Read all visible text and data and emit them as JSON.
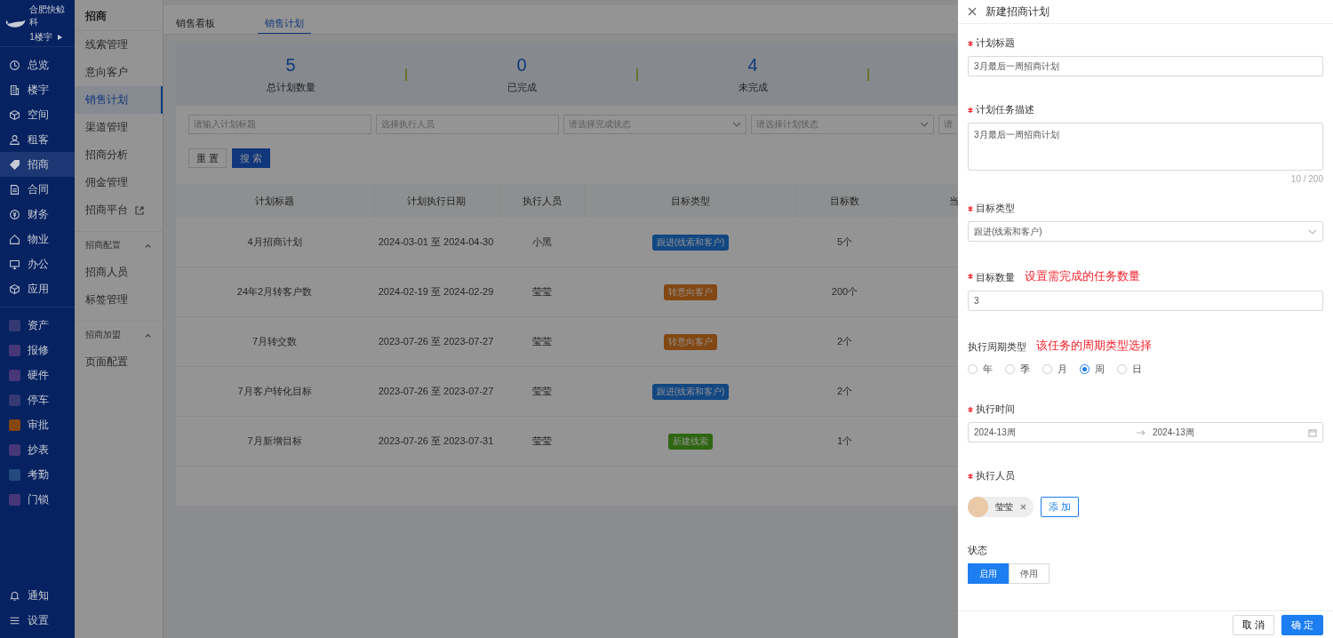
{
  "sidebar": {
    "org_name": "合肥快鲸科",
    "building": "1楼宇",
    "items": [
      {
        "kind": "nav",
        "label": "总览",
        "selected": false
      },
      {
        "kind": "nav",
        "label": "楼宇",
        "selected": false
      },
      {
        "kind": "nav",
        "label": "空间",
        "selected": false
      },
      {
        "kind": "nav",
        "label": "租客",
        "selected": false
      },
      {
        "kind": "nav",
        "label": "招商",
        "selected": true
      },
      {
        "kind": "nav",
        "label": "合同",
        "selected": false
      },
      {
        "kind": "nav",
        "label": "财务",
        "selected": false
      },
      {
        "kind": "nav",
        "label": "物业",
        "selected": false
      },
      {
        "kind": "nav",
        "label": "办公",
        "selected": false
      },
      {
        "kind": "nav",
        "label": "应用",
        "selected": false
      },
      {
        "kind": "app",
        "label": "资产",
        "color": "#343974",
        "selected": false
      },
      {
        "kind": "app",
        "label": "报修",
        "color": "#473779",
        "selected": false
      },
      {
        "kind": "app",
        "label": "硬件",
        "color": "#473779",
        "selected": false
      },
      {
        "kind": "app",
        "label": "停车",
        "color": "#343974",
        "selected": false
      },
      {
        "kind": "app",
        "label": "审批",
        "color": "#864611",
        "selected": false
      },
      {
        "kind": "app",
        "label": "抄表",
        "color": "#473779",
        "selected": false
      },
      {
        "kind": "app",
        "label": "考勤",
        "color": "#224a7d",
        "selected": false
      },
      {
        "kind": "app",
        "label": "门锁",
        "color": "#473779",
        "selected": false
      }
    ],
    "bottom_items": [
      {
        "label": "通知"
      },
      {
        "label": "设置"
      }
    ]
  },
  "submenu": {
    "title": "招商",
    "items": [
      {
        "label": "线索管理",
        "selected": false
      },
      {
        "label": "意向客户",
        "selected": false
      },
      {
        "label": "销售计划",
        "selected": true
      },
      {
        "label": "渠道管理",
        "selected": false
      },
      {
        "label": "招商分析",
        "selected": false
      },
      {
        "label": "佣金管理",
        "selected": false
      },
      {
        "label": "招商平台",
        "selected": false,
        "external": true
      }
    ],
    "groups": [
      {
        "title": "招商配置",
        "expanded": true,
        "items": [
          {
            "label": "招商人员",
            "selected": false
          },
          {
            "label": "标签管理",
            "selected": false
          }
        ]
      },
      {
        "title": "招商加盟",
        "expanded": true,
        "items": [
          {
            "label": "页面配置",
            "selected": false
          }
        ]
      }
    ]
  },
  "tabs": [
    {
      "label": "销售看板",
      "selected": false
    },
    {
      "label": "销售计划",
      "selected": true
    }
  ],
  "stats": [
    {
      "value": "5",
      "label": "总计划数量"
    },
    {
      "value": "0",
      "label": "已完成"
    },
    {
      "value": "4",
      "label": "未完成"
    }
  ],
  "filters": [
    {
      "kind": "input",
      "placeholder": "请输入计划标题"
    },
    {
      "kind": "input",
      "placeholder": "选择执行人员"
    },
    {
      "kind": "select",
      "placeholder": "请选择完成状态"
    },
    {
      "kind": "select",
      "placeholder": "请选择计划状态"
    },
    {
      "kind": "input",
      "placeholder": "请"
    }
  ],
  "filter_buttons": {
    "reset": "重 置",
    "search": "搜 索"
  },
  "table": {
    "columns": [
      "计划标题",
      "计划执行日期",
      "执行人员",
      "目标类型",
      "目标数",
      "当"
    ],
    "rows": [
      {
        "title": "4月招商计划",
        "date": "2024-03-01 至 2024-04-30",
        "person": "小黑",
        "type": "跟进(线索和客户)",
        "color": "#124782",
        "count": "5个"
      },
      {
        "title": "24年2月转客户数",
        "date": "2024-02-19 至 2024-02-29",
        "person": "莹莹",
        "type": "转意向客户",
        "color": "#824712",
        "count": "200个"
      },
      {
        "title": "7月转交数",
        "date": "2023-07-26 至 2023-07-27",
        "person": "莹莹",
        "type": "转意向客户",
        "color": "#824712",
        "count": "2个"
      },
      {
        "title": "7月客户转化目标",
        "date": "2023-07-26 至 2023-07-27",
        "person": "莹莹",
        "type": "跟进(线索和客户)",
        "color": "#124782",
        "count": "2个"
      },
      {
        "title": "7月新增目标",
        "date": "2023-07-26 至 2023-07-31",
        "person": "莹莹",
        "type": "新建线索",
        "color": "#2f6611",
        "count": "1个"
      }
    ]
  },
  "drawer": {
    "title": "新建招商计划",
    "plan_title": {
      "label": "计划标题",
      "required": true,
      "value": "3月最后一周招商计划"
    },
    "description": {
      "label": "计划任务描述",
      "required": true,
      "value": "3月最后一周招商计划",
      "counter": "10 / 200"
    },
    "target_type": {
      "label": "目标类型",
      "required": true,
      "value": "跟进(线索和客户)"
    },
    "target_count": {
      "label": "目标数量",
      "required": true,
      "value": "3",
      "annotation": "设置需完成的任务数量"
    },
    "cycle_type": {
      "label": "执行周期类型",
      "required": false,
      "annotation": "该任务的周期类型选择",
      "options": [
        {
          "label": "年",
          "selected": false
        },
        {
          "label": "季",
          "selected": false
        },
        {
          "label": "月",
          "selected": false
        },
        {
          "label": "周",
          "selected": true
        },
        {
          "label": "日",
          "selected": false
        }
      ]
    },
    "exec_time": {
      "label": "执行时间",
      "required": true,
      "start": "2024-13周",
      "end": "2024-13周"
    },
    "executors": {
      "label": "执行人员",
      "required": true,
      "people": [
        "莹莹"
      ],
      "add_button": "添 加"
    },
    "status": {
      "label": "状态",
      "options": [
        {
          "label": "启用",
          "selected": true
        },
        {
          "label": "停用",
          "selected": false
        }
      ]
    },
    "cancel": "取 消",
    "confirm": "确 定"
  }
}
